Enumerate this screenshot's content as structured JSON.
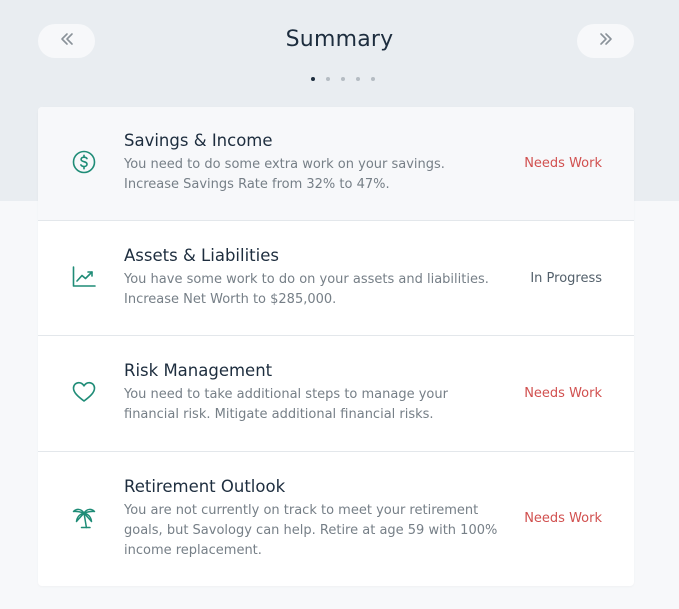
{
  "header": {
    "title": "Summary",
    "prev_icon": "double-chevron-left-icon",
    "next_icon": "double-chevron-right-icon",
    "page_count": 5,
    "active_page": 1
  },
  "colors": {
    "accent": "#1f8c77",
    "needs_work": "#d1504f",
    "in_progress": "#53606b",
    "title": "#1d2d3e"
  },
  "items": [
    {
      "icon": "dollar-circle-icon",
      "title": "Savings & Income",
      "description": [
        "You need to do some extra work on your savings.",
        "Increase Savings Rate from 32% to 47%."
      ],
      "status": "Needs Work"
    },
    {
      "icon": "chart-trend-up-icon",
      "title": "Assets & Liabilities",
      "description": [
        "You have some work to do on your assets and liabilities.",
        "Increase Net Worth to $285,000."
      ],
      "status": "In Progress"
    },
    {
      "icon": "heart-icon",
      "title": "Risk Management",
      "description": [
        "You need to take additional steps to manage your",
        "financial risk. Mitigate additional financial risks."
      ],
      "status": "Needs Work"
    },
    {
      "icon": "palm-tree-icon",
      "title": "Retirement Outlook",
      "description": [
        "You are not currently on track to meet your retirement",
        "goals, but Savology can help. Retire at age 59 with 100%",
        "income replacement."
      ],
      "status": "Needs Work"
    }
  ]
}
